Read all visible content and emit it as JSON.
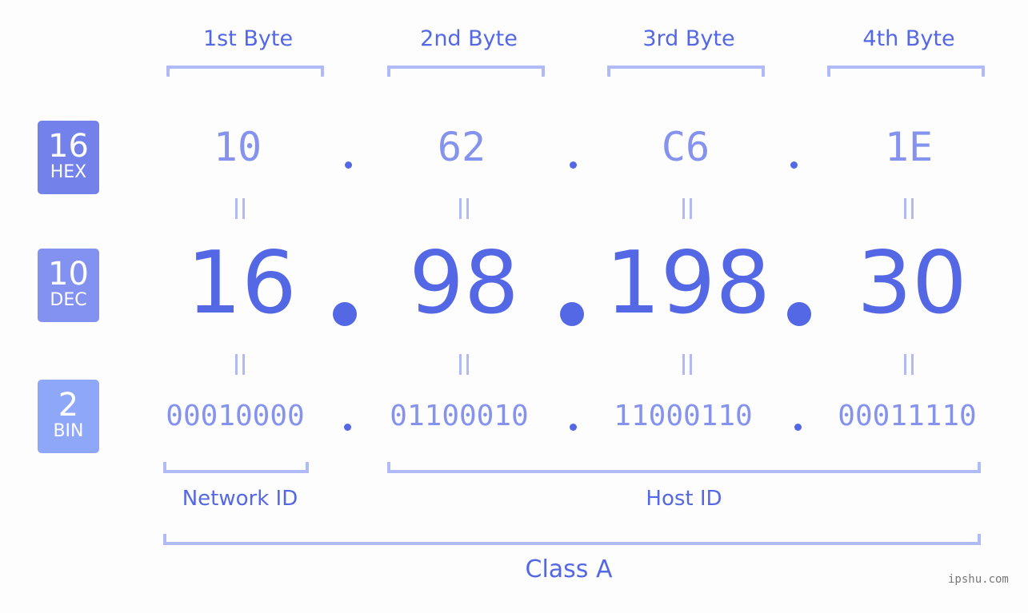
{
  "bytes": [
    {
      "header": "1st Byte",
      "hex": "10",
      "dec": "16",
      "bin": "00010000"
    },
    {
      "header": "2nd Byte",
      "hex": "62",
      "dec": "98",
      "bin": "01100010"
    },
    {
      "header": "3rd Byte",
      "hex": "C6",
      "dec": "198",
      "bin": "11000110"
    },
    {
      "header": "4th Byte",
      "hex": "1E",
      "dec": "30",
      "bin": "00011110"
    }
  ],
  "badges": {
    "hex": {
      "num": "16",
      "label": "HEX",
      "color": "#7381ea"
    },
    "dec": {
      "num": "10",
      "label": "DEC",
      "color": "#8391f0"
    },
    "bin": {
      "num": "2",
      "label": "BIN",
      "color": "#8fa7f8"
    }
  },
  "labels": {
    "network_id": "Network ID",
    "host_id": "Host ID",
    "class": "Class A"
  },
  "watermark": "ipshu.com"
}
